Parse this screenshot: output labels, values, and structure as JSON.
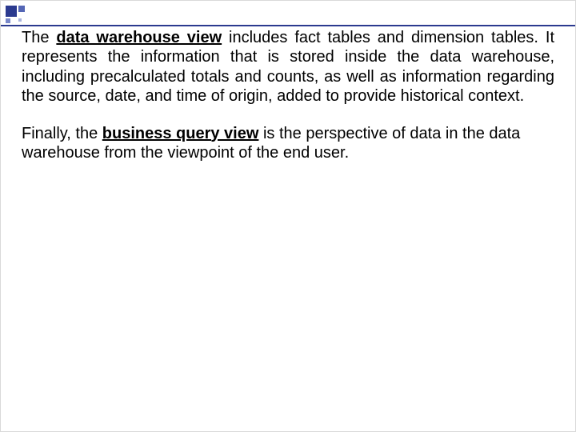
{
  "paragraphs": {
    "p1": {
      "lead": "The ",
      "bold_underline": "data warehouse view",
      "rest": " includes fact tables and dimension tables. It represents the information that is stored inside the data warehouse, including precalculated totals and counts, as well as information regarding the source, date, and time of origin, added to provide historical context."
    },
    "p2": {
      "lead": "Finally, the ",
      "bold_underline": "business query view",
      "rest": " is the perspective of data in the data warehouse from the viewpoint of the end user."
    }
  }
}
